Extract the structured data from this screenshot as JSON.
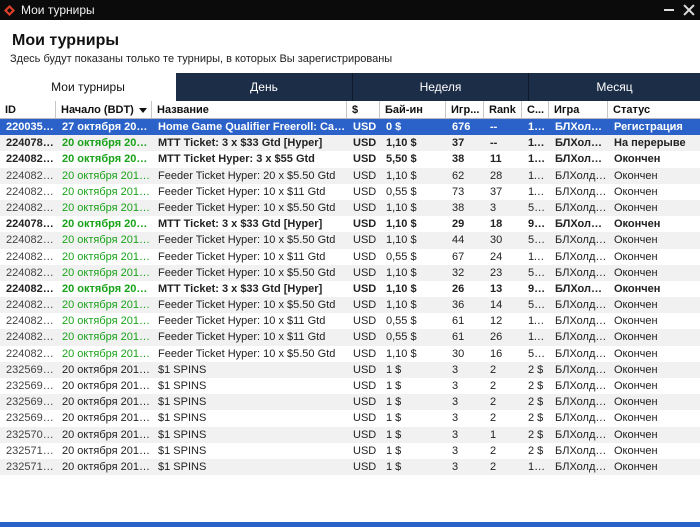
{
  "window": {
    "title": "Мои турниры",
    "accent": "#e0402a"
  },
  "header": {
    "title": "Мои турниры",
    "subtitle": "Здесь будут показаны только те турниры, в которых Вы зарегистрированы"
  },
  "tabs": [
    {
      "label": "Мои турниры",
      "active": true
    },
    {
      "label": "День",
      "active": false
    },
    {
      "label": "Неделя",
      "active": false
    },
    {
      "label": "Месяц",
      "active": false
    }
  ],
  "columns": [
    "ID",
    "Начало (BDT)",
    "Название",
    "$",
    "Бай-ин",
    "Игр...",
    "Rank",
    "С...",
    "Игра",
    "Статус"
  ],
  "rows": [
    {
      "id": "2200356...",
      "start": "27 октября 2019 ...",
      "name": "Home Game Qualifier Freeroll: Caribb...",
      "cur": "USD",
      "buyin": "0 $",
      "games": "676",
      "rank": "--",
      "s": "17 ...",
      "game": "БЛХолдем",
      "status": "Регистрация",
      "style": "sel",
      "green": false
    },
    {
      "id": "2240789...",
      "start": "20 октября 2019 ...",
      "name": "MTT Ticket: 3 x $33 Gtd [Hyper]",
      "cur": "USD",
      "buyin": "1,10 $",
      "games": "37",
      "rank": "--",
      "s": "11...",
      "game": "БЛХолдем",
      "status": "На перерыве",
      "style": "bold",
      "green": true
    },
    {
      "id": "2240825...",
      "start": "20 октября 2019 ...",
      "name": "MTT Ticket Hyper: 3 x $55 Gtd",
      "cur": "USD",
      "buyin": "5,50 $",
      "games": "38",
      "rank": "11",
      "s": "19...",
      "game": "БЛХолдем",
      "status": "Окончен",
      "style": "bold",
      "green": true
    },
    {
      "id": "2240823...",
      "start": "20 октября 2019 ...",
      "name": "Feeder Ticket Hyper: 20 x $5.50 Gtd",
      "cur": "USD",
      "buyin": "1,10 $",
      "games": "62",
      "rank": "28",
      "s": "11 ...",
      "game": "БЛХолдем",
      "status": "Окончен",
      "style": "",
      "green": true
    },
    {
      "id": "2240828...",
      "start": "20 октября 2019 ...",
      "name": "Feeder Ticket Hyper: 10 x $11 Gtd",
      "cur": "USD",
      "buyin": "0,55 $",
      "games": "73",
      "rank": "37",
      "s": "11 ...",
      "game": "БЛХолдем",
      "status": "Окончен",
      "style": "",
      "green": true
    },
    {
      "id": "2240822...",
      "start": "20 октября 2019 ...",
      "name": "Feeder Ticket Hyper: 10 x $5.50 Gtd",
      "cur": "USD",
      "buyin": "1,10 $",
      "games": "38",
      "rank": "3",
      "s": "55 $",
      "game": "БЛХолдем",
      "status": "Окончен",
      "style": "",
      "green": true
    },
    {
      "id": "2240789...",
      "start": "20 октября 2019 ...",
      "name": "MTT Ticket: 3 x $33 Gtd [Hyper]",
      "cur": "USD",
      "buyin": "1,10 $",
      "games": "29",
      "rank": "18",
      "s": "99 $",
      "game": "БЛХолдем",
      "status": "Окончен",
      "style": "bold",
      "green": true
    },
    {
      "id": "2240822...",
      "start": "20 октября 2019 ...",
      "name": "Feeder Ticket Hyper: 10 x $5.50 Gtd",
      "cur": "USD",
      "buyin": "1,10 $",
      "games": "44",
      "rank": "30",
      "s": "55 $",
      "game": "БЛХолдем",
      "status": "Окончен",
      "style": "",
      "green": true
    },
    {
      "id": "2240828...",
      "start": "20 октября 2019 ...",
      "name": "Feeder Ticket Hyper: 10 x $11 Gtd",
      "cur": "USD",
      "buyin": "0,55 $",
      "games": "67",
      "rank": "24",
      "s": "11 ...",
      "game": "БЛХолдем",
      "status": "Окончен",
      "style": "",
      "green": true
    },
    {
      "id": "2240822...",
      "start": "20 октября 2019 ...",
      "name": "Feeder Ticket Hyper: 10 x $5.50 Gtd",
      "cur": "USD",
      "buyin": "1,10 $",
      "games": "32",
      "rank": "23",
      "s": "55 $",
      "game": "БЛХолдем",
      "status": "Окончен",
      "style": "",
      "green": true
    },
    {
      "id": "2240826...",
      "start": "20 октября 2019 ...",
      "name": "MTT Ticket: 3 x $33 Gtd [Hyper]",
      "cur": "USD",
      "buyin": "1,10 $",
      "games": "26",
      "rank": "13",
      "s": "99 $",
      "game": "БЛХолдем",
      "status": "Окончен",
      "style": "bold",
      "green": true
    },
    {
      "id": "2240822...",
      "start": "20 октября 2019 ...",
      "name": "Feeder Ticket Hyper: 10 x $5.50 Gtd",
      "cur": "USD",
      "buyin": "1,10 $",
      "games": "36",
      "rank": "14",
      "s": "55 $",
      "game": "БЛХолдем",
      "status": "Окончен",
      "style": "",
      "green": true
    },
    {
      "id": "2240828...",
      "start": "20 октября 2019 ...",
      "name": "Feeder Ticket Hyper: 10 x $11 Gtd",
      "cur": "USD",
      "buyin": "0,55 $",
      "games": "61",
      "rank": "12",
      "s": "11 ...",
      "game": "БЛХолдем",
      "status": "Окончен",
      "style": "",
      "green": true
    },
    {
      "id": "2240828...",
      "start": "20 октября 2019 ...",
      "name": "Feeder Ticket Hyper: 10 x $11 Gtd",
      "cur": "USD",
      "buyin": "0,55 $",
      "games": "61",
      "rank": "26",
      "s": "11 ...",
      "game": "БЛХолдем",
      "status": "Окончен",
      "style": "",
      "green": true
    },
    {
      "id": "2240822...",
      "start": "20 октября 2019 ...",
      "name": "Feeder Ticket Hyper: 10 x $5.50 Gtd",
      "cur": "USD",
      "buyin": "1,10 $",
      "games": "30",
      "rank": "16",
      "s": "55 $",
      "game": "БЛХолдем",
      "status": "Окончен",
      "style": "",
      "green": true
    },
    {
      "id": "2325692...",
      "start": "20 октября 2019 ...",
      "name": "$1 SPINS",
      "cur": "USD",
      "buyin": "1 $",
      "games": "3",
      "rank": "2",
      "s": "2 $",
      "game": "БЛХолдем",
      "status": "Окончен",
      "style": "",
      "green": false
    },
    {
      "id": "2325692...",
      "start": "20 октября 2019 ...",
      "name": "$1 SPINS",
      "cur": "USD",
      "buyin": "1 $",
      "games": "3",
      "rank": "2",
      "s": "2 $",
      "game": "БЛХолдем",
      "status": "Окончен",
      "style": "",
      "green": false
    },
    {
      "id": "2325692...",
      "start": "20 октября 2019 ...",
      "name": "$1 SPINS",
      "cur": "USD",
      "buyin": "1 $",
      "games": "3",
      "rank": "2",
      "s": "2 $",
      "game": "БЛХолдем",
      "status": "Окончен",
      "style": "",
      "green": false
    },
    {
      "id": "2325699...",
      "start": "20 октября 2019 ...",
      "name": "$1 SPINS",
      "cur": "USD",
      "buyin": "1 $",
      "games": "3",
      "rank": "2",
      "s": "2 $",
      "game": "БЛХолдем",
      "status": "Окончен",
      "style": "",
      "green": false
    },
    {
      "id": "2325705...",
      "start": "20 октября 2019 ...",
      "name": "$1 SPINS",
      "cur": "USD",
      "buyin": "1 $",
      "games": "3",
      "rank": "1",
      "s": "2 $",
      "game": "БЛХолдем",
      "status": "Окончен",
      "style": "",
      "green": false
    },
    {
      "id": "2325717...",
      "start": "20 октября 2019 ...",
      "name": "$1 SPINS",
      "cur": "USD",
      "buyin": "1 $",
      "games": "3",
      "rank": "2",
      "s": "2 $",
      "game": "БЛХолдем",
      "status": "Окончен",
      "style": "",
      "green": false
    },
    {
      "id": "2325718...",
      "start": "20 октября 2019 ...",
      "name": "$1 SPINS",
      "cur": "USD",
      "buyin": "1 $",
      "games": "3",
      "rank": "2",
      "s": "10 ...",
      "game": "БЛХолдем",
      "status": "Окончен",
      "style": "",
      "green": false
    }
  ]
}
